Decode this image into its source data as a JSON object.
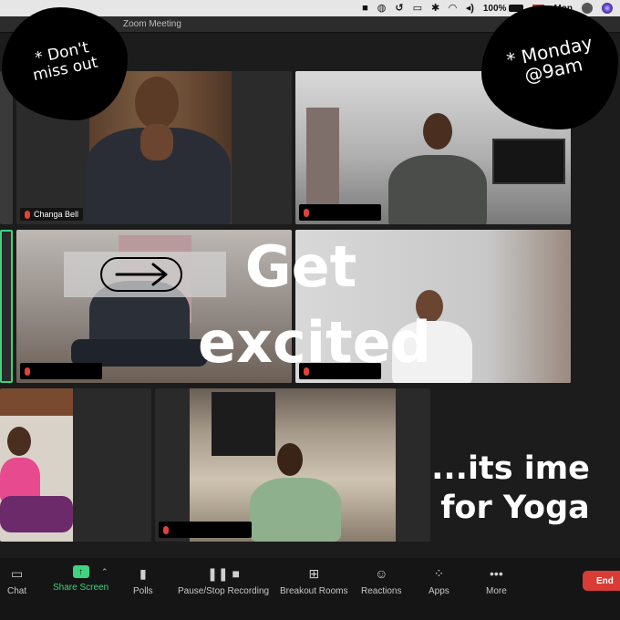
{
  "menubar": {
    "battery": "100%",
    "day": "Mon"
  },
  "window": {
    "title": "Zoom Meeting"
  },
  "participants": [
    {
      "name": "Changa Bell"
    }
  ],
  "stickers": {
    "left": "* Don't\nmiss out",
    "right": "* Monday\n@9am"
  },
  "headline": {
    "line1": "Get",
    "line2": "excited",
    "tagline1": "...its ime",
    "tagline2": "for Yoga"
  },
  "toolbar": {
    "chat": "Chat",
    "share": "Share Screen",
    "polls": "Polls",
    "record": "Pause/Stop Recording",
    "breakout": "Breakout Rooms",
    "reactions": "Reactions",
    "apps": "Apps",
    "more": "More",
    "end": "End"
  },
  "colors": {
    "share_green": "#3fd27f",
    "end_red": "#d93b35",
    "active_speaker": "#3fd27f"
  },
  "icons": [
    "chat-icon",
    "share-screen-icon",
    "polls-icon",
    "record-icon",
    "breakout-rooms-icon",
    "reactions-icon",
    "apps-icon",
    "more-icon"
  ]
}
